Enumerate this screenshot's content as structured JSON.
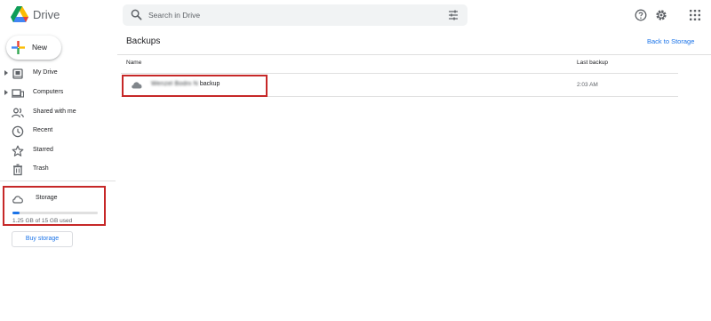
{
  "app": {
    "title": "Drive"
  },
  "search": {
    "placeholder": "Search in Drive",
    "value": ""
  },
  "topbar": {
    "icons": [
      "help-icon",
      "settings-icon",
      "apps-grid-icon"
    ]
  },
  "sidebar": {
    "new_label": "New",
    "items": [
      {
        "label": "My Drive",
        "icon": "my-drive-icon",
        "expandable": true
      },
      {
        "label": "Computers",
        "icon": "computers-icon",
        "expandable": true
      },
      {
        "label": "Shared with me",
        "icon": "shared-icon",
        "expandable": false
      },
      {
        "label": "Recent",
        "icon": "clock-icon",
        "expandable": false
      },
      {
        "label": "Starred",
        "icon": "star-icon",
        "expandable": false
      },
      {
        "label": "Trash",
        "icon": "trash-icon",
        "expandable": false
      }
    ],
    "storage": {
      "label": "Storage",
      "used_text": "1.25 GB of 15 GB used",
      "used_fraction": 0.083
    },
    "buy_storage_label": "Buy storage"
  },
  "main": {
    "title": "Backups",
    "back_link": "Back to Storage",
    "columns": {
      "name": "Name",
      "last_backup": "Last backup"
    },
    "rows": [
      {
        "name_hidden": "Wenzel Bodni N",
        "name_suffix": "backup",
        "last_backup": "2:03 AM",
        "icon": "cloud-icon"
      }
    ]
  },
  "colors": {
    "accent": "#1a73e8",
    "highlight_box": "#c62828",
    "search_bg": "#f1f3f4",
    "icon_gray": "#5f6368"
  }
}
